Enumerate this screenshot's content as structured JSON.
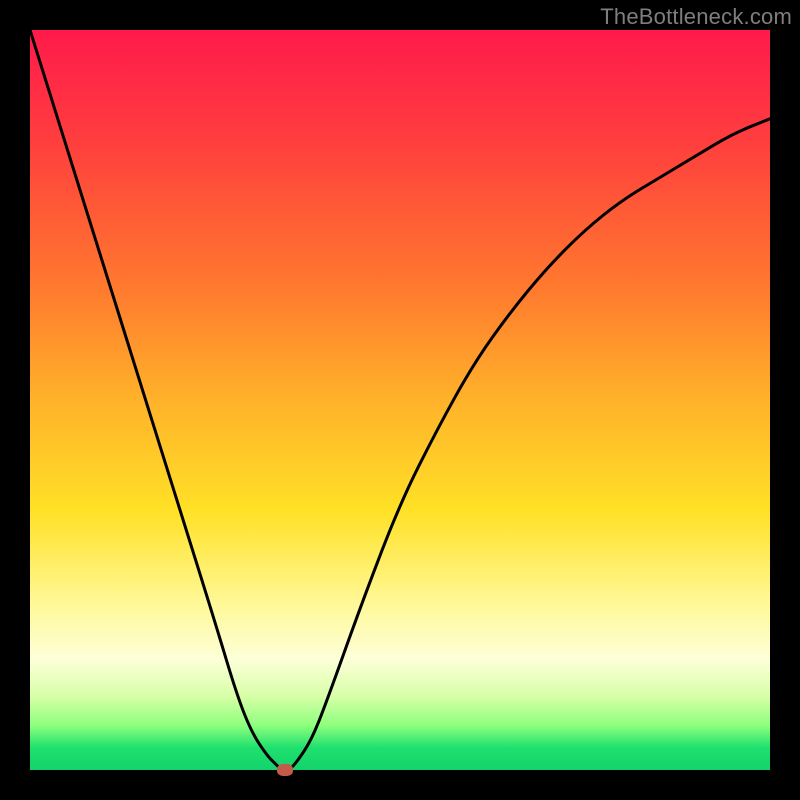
{
  "watermark": "TheBottleneck.com",
  "chart_data": {
    "type": "line",
    "title": "",
    "xlabel": "",
    "ylabel": "",
    "xlim": [
      0,
      100
    ],
    "ylim": [
      0,
      100
    ],
    "grid": false,
    "legend": false,
    "series": [
      {
        "name": "bottleneck-curve",
        "x": [
          0,
          5,
          10,
          15,
          20,
          25,
          28,
          30,
          32,
          33,
          34,
          35,
          36,
          38,
          40,
          45,
          50,
          55,
          60,
          65,
          70,
          75,
          80,
          85,
          90,
          95,
          100
        ],
        "y": [
          100,
          84,
          68,
          52,
          36,
          20,
          10,
          5,
          2,
          1,
          0,
          0,
          1,
          4,
          9,
          23,
          36,
          46,
          55,
          62,
          68,
          73,
          77,
          80,
          83,
          86,
          88
        ]
      }
    ],
    "marker": {
      "x": 34.5,
      "y": 0
    },
    "background_gradient": {
      "top": "#ff1a4b",
      "mid": "#ffe126",
      "bottom": "#13d36b"
    }
  }
}
